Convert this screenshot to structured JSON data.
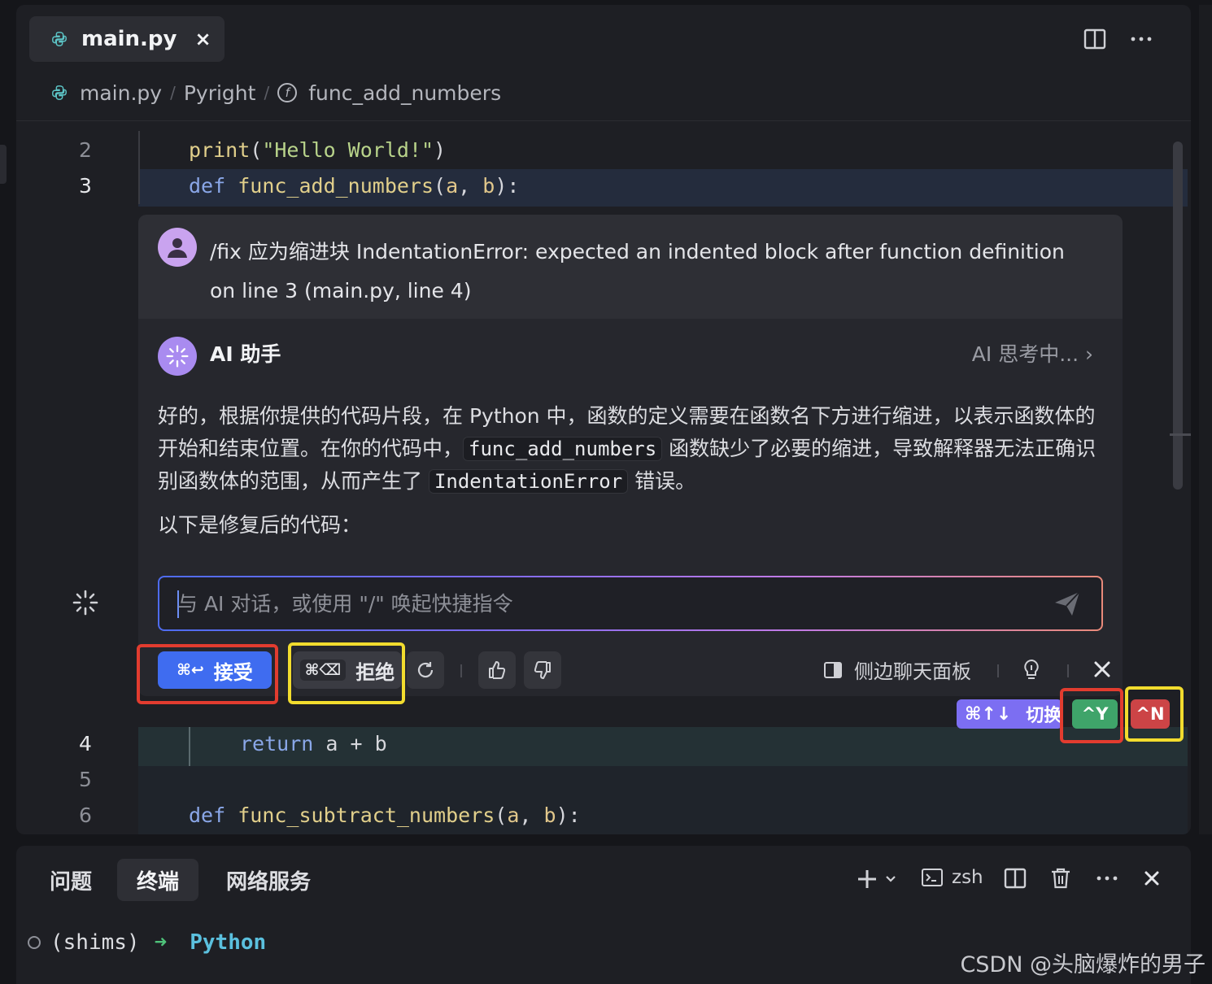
{
  "tab": {
    "filename": "main.py",
    "close": "×"
  },
  "breadcrumb": {
    "file": "main.py",
    "provider": "Pyright",
    "symbol": "func_add_numbers"
  },
  "editor": {
    "line_numbers": [
      "2",
      "3",
      "4",
      "5",
      "6"
    ],
    "line2": {
      "fn": "print",
      "open": "(",
      "str": "\"Hello World!\"",
      "close": ")"
    },
    "line3": {
      "kw": "def",
      "fn": "func_add_numbers",
      "open": "(",
      "p1": "a",
      "comma": ", ",
      "p2": "b",
      "close": "):"
    },
    "line4": {
      "kw": "return",
      "rest": " a + b"
    },
    "line6": {
      "kw": "def",
      "fn": "func_subtract_numbers",
      "open": "(",
      "p1": "a",
      "comma": ", ",
      "p2": "b",
      "close": "):"
    }
  },
  "ai_panel": {
    "user_message": "/fix 应为缩进块 IndentationError: expected an indented block after function definition on line 3 (main.py, line 4)",
    "assistant_name": "AI 助手",
    "thinking_label": "AI 思考中... ›",
    "response_part1": "好的，根据你提供的代码片段，在 Python 中，函数的定义需要在函数名下方进行缩进，以表示函数体的开始和结束位置。在你的代码中，",
    "response_code1": "func_add_numbers",
    "response_part2": " 函数缺少了必要的缩进，导致解释器无法正确识别函数体的范围，从而产生了 ",
    "response_code2": "IndentationError",
    "response_part3": " 错误。",
    "response_followup": "以下是修复后的代码：",
    "input_placeholder": "与 AI 对话，或使用 \"/\" 唤起快捷指令",
    "accept_shortcut": "⌘↩",
    "accept_label": "接受",
    "reject_shortcut": "⌘⌫",
    "reject_label": "拒绝",
    "sidebar_label": "侧边聊天面板"
  },
  "diff_controls": {
    "switch_shortcut": "⌘↑↓",
    "switch_label": "切换",
    "accept_key": "^Y",
    "reject_key": "^N"
  },
  "bottom_panel": {
    "tabs": [
      "问题",
      "终端",
      "网络服务"
    ],
    "terminal_name": "zsh",
    "prompt_env": "(shims)",
    "prompt_arrow": "➜",
    "prompt_dir": "Python"
  },
  "watermark": "CSDN @头脑爆炸的男子",
  "colors": {
    "accent": "#3f6cf0",
    "accept_key": "#3fa46a",
    "reject_key": "#cc4446",
    "switch": "#7c6ef2",
    "highlight_red": "#e23c2f",
    "highlight_yellow": "#f2dc2e"
  }
}
